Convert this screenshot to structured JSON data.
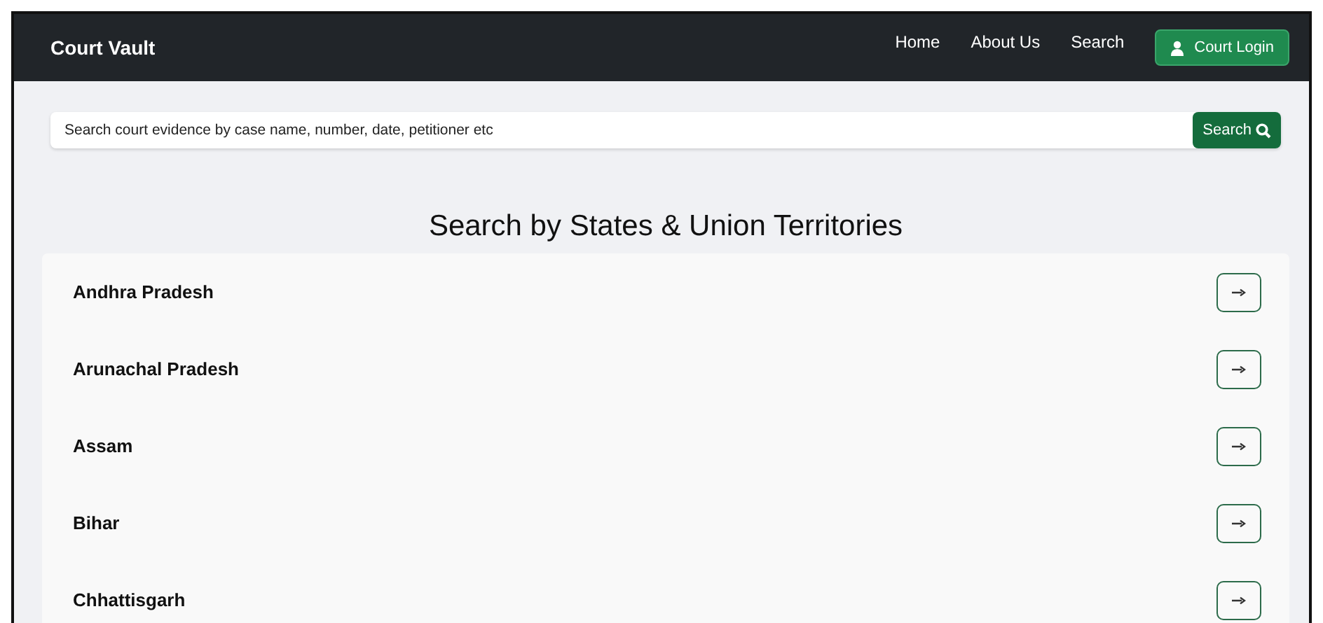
{
  "navbar": {
    "brand": "Court Vault",
    "links": [
      "Home",
      "About Us",
      "Search"
    ],
    "login_button": "Court Login"
  },
  "search": {
    "placeholder": "Search court evidence by case name, number, date, petitioner etc",
    "button": "Search"
  },
  "heading": "Search by States & Union Territories",
  "states": [
    "Andhra Pradesh",
    "Arunachal Pradesh",
    "Assam",
    "Bihar",
    "Chhattisgarh"
  ]
}
